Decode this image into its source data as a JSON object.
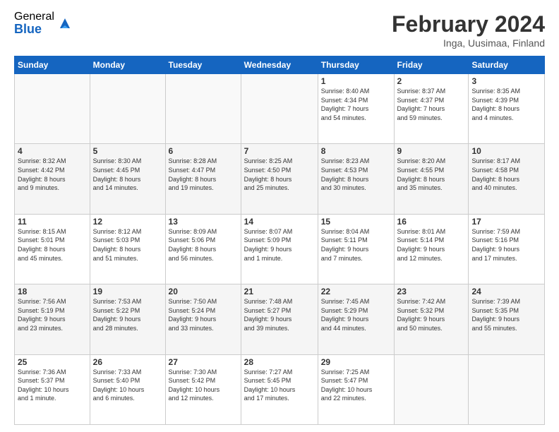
{
  "logo": {
    "general": "General",
    "blue": "Blue"
  },
  "title": {
    "month": "February 2024",
    "location": "Inga, Uusimaa, Finland"
  },
  "days_of_week": [
    "Sunday",
    "Monday",
    "Tuesday",
    "Wednesday",
    "Thursday",
    "Friday",
    "Saturday"
  ],
  "weeks": [
    [
      {
        "day": "",
        "info": ""
      },
      {
        "day": "",
        "info": ""
      },
      {
        "day": "",
        "info": ""
      },
      {
        "day": "",
        "info": ""
      },
      {
        "day": "1",
        "info": "Sunrise: 8:40 AM\nSunset: 4:34 PM\nDaylight: 7 hours\nand 54 minutes."
      },
      {
        "day": "2",
        "info": "Sunrise: 8:37 AM\nSunset: 4:37 PM\nDaylight: 7 hours\nand 59 minutes."
      },
      {
        "day": "3",
        "info": "Sunrise: 8:35 AM\nSunset: 4:39 PM\nDaylight: 8 hours\nand 4 minutes."
      }
    ],
    [
      {
        "day": "4",
        "info": "Sunrise: 8:32 AM\nSunset: 4:42 PM\nDaylight: 8 hours\nand 9 minutes."
      },
      {
        "day": "5",
        "info": "Sunrise: 8:30 AM\nSunset: 4:45 PM\nDaylight: 8 hours\nand 14 minutes."
      },
      {
        "day": "6",
        "info": "Sunrise: 8:28 AM\nSunset: 4:47 PM\nDaylight: 8 hours\nand 19 minutes."
      },
      {
        "day": "7",
        "info": "Sunrise: 8:25 AM\nSunset: 4:50 PM\nDaylight: 8 hours\nand 25 minutes."
      },
      {
        "day": "8",
        "info": "Sunrise: 8:23 AM\nSunset: 4:53 PM\nDaylight: 8 hours\nand 30 minutes."
      },
      {
        "day": "9",
        "info": "Sunrise: 8:20 AM\nSunset: 4:55 PM\nDaylight: 8 hours\nand 35 minutes."
      },
      {
        "day": "10",
        "info": "Sunrise: 8:17 AM\nSunset: 4:58 PM\nDaylight: 8 hours\nand 40 minutes."
      }
    ],
    [
      {
        "day": "11",
        "info": "Sunrise: 8:15 AM\nSunset: 5:01 PM\nDaylight: 8 hours\nand 45 minutes."
      },
      {
        "day": "12",
        "info": "Sunrise: 8:12 AM\nSunset: 5:03 PM\nDaylight: 8 hours\nand 51 minutes."
      },
      {
        "day": "13",
        "info": "Sunrise: 8:09 AM\nSunset: 5:06 PM\nDaylight: 8 hours\nand 56 minutes."
      },
      {
        "day": "14",
        "info": "Sunrise: 8:07 AM\nSunset: 5:09 PM\nDaylight: 9 hours\nand 1 minute."
      },
      {
        "day": "15",
        "info": "Sunrise: 8:04 AM\nSunset: 5:11 PM\nDaylight: 9 hours\nand 7 minutes."
      },
      {
        "day": "16",
        "info": "Sunrise: 8:01 AM\nSunset: 5:14 PM\nDaylight: 9 hours\nand 12 minutes."
      },
      {
        "day": "17",
        "info": "Sunrise: 7:59 AM\nSunset: 5:16 PM\nDaylight: 9 hours\nand 17 minutes."
      }
    ],
    [
      {
        "day": "18",
        "info": "Sunrise: 7:56 AM\nSunset: 5:19 PM\nDaylight: 9 hours\nand 23 minutes."
      },
      {
        "day": "19",
        "info": "Sunrise: 7:53 AM\nSunset: 5:22 PM\nDaylight: 9 hours\nand 28 minutes."
      },
      {
        "day": "20",
        "info": "Sunrise: 7:50 AM\nSunset: 5:24 PM\nDaylight: 9 hours\nand 33 minutes."
      },
      {
        "day": "21",
        "info": "Sunrise: 7:48 AM\nSunset: 5:27 PM\nDaylight: 9 hours\nand 39 minutes."
      },
      {
        "day": "22",
        "info": "Sunrise: 7:45 AM\nSunset: 5:29 PM\nDaylight: 9 hours\nand 44 minutes."
      },
      {
        "day": "23",
        "info": "Sunrise: 7:42 AM\nSunset: 5:32 PM\nDaylight: 9 hours\nand 50 minutes."
      },
      {
        "day": "24",
        "info": "Sunrise: 7:39 AM\nSunset: 5:35 PM\nDaylight: 9 hours\nand 55 minutes."
      }
    ],
    [
      {
        "day": "25",
        "info": "Sunrise: 7:36 AM\nSunset: 5:37 PM\nDaylight: 10 hours\nand 1 minute."
      },
      {
        "day": "26",
        "info": "Sunrise: 7:33 AM\nSunset: 5:40 PM\nDaylight: 10 hours\nand 6 minutes."
      },
      {
        "day": "27",
        "info": "Sunrise: 7:30 AM\nSunset: 5:42 PM\nDaylight: 10 hours\nand 12 minutes."
      },
      {
        "day": "28",
        "info": "Sunrise: 7:27 AM\nSunset: 5:45 PM\nDaylight: 10 hours\nand 17 minutes."
      },
      {
        "day": "29",
        "info": "Sunrise: 7:25 AM\nSunset: 5:47 PM\nDaylight: 10 hours\nand 22 minutes."
      },
      {
        "day": "",
        "info": ""
      },
      {
        "day": "",
        "info": ""
      }
    ]
  ]
}
